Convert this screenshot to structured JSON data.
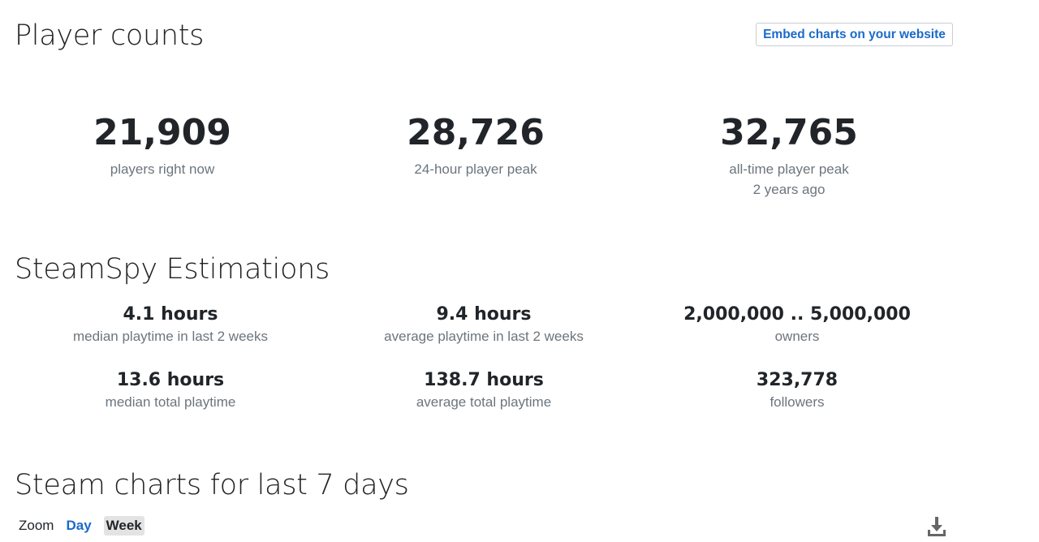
{
  "player_counts": {
    "title": "Player counts",
    "embed_label": "Embed charts on your website",
    "stats": [
      {
        "value": "21,909",
        "label": "players right now",
        "sub": ""
      },
      {
        "value": "28,726",
        "label": "24-hour player peak",
        "sub": ""
      },
      {
        "value": "32,765",
        "label": "all-time player peak",
        "sub": "2 years ago"
      }
    ]
  },
  "steamspy": {
    "title": "SteamSpy Estimations",
    "items": [
      {
        "value": "4.1 hours",
        "label": "median playtime in last 2 weeks"
      },
      {
        "value": "9.4 hours",
        "label": "average playtime in last 2 weeks"
      },
      {
        "value": "2,000,000 .. 5,000,000",
        "label": "owners"
      },
      {
        "value": "13.6 hours",
        "label": "median total playtime"
      },
      {
        "value": "138.7 hours",
        "label": "average total playtime"
      },
      {
        "value": "323,778",
        "label": "followers"
      }
    ]
  },
  "charts": {
    "title": "Steam charts for last 7 days",
    "zoom_label": "Zoom",
    "zoom_options": [
      "Day",
      "Week"
    ],
    "zoom_selected": "Week",
    "download_icon": "download-icon"
  },
  "colors": {
    "link": "#1b6ac9",
    "muted": "#6c757d",
    "active_bg": "#e3e3e3"
  }
}
